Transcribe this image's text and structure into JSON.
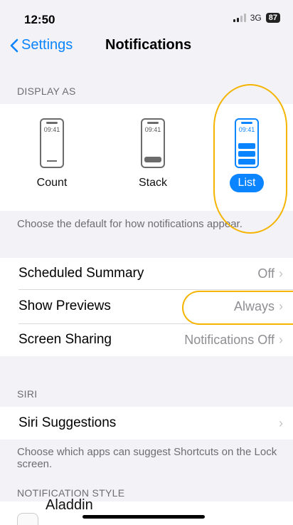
{
  "status_bar": {
    "time": "12:50",
    "network": "3G",
    "battery": "87"
  },
  "nav": {
    "back_label": "Settings",
    "title": "Notifications"
  },
  "display_as": {
    "header": "DISPLAY AS",
    "options": [
      {
        "label": "Count",
        "clock": "09:41",
        "selected": false
      },
      {
        "label": "Stack",
        "clock": "09:41",
        "selected": false
      },
      {
        "label": "List",
        "clock": "09:41",
        "selected": true
      }
    ],
    "footer": "Choose the default for how notifications appear."
  },
  "settings_rows": [
    {
      "label": "Scheduled Summary",
      "value": "Off"
    },
    {
      "label": "Show Previews",
      "value": "Always"
    },
    {
      "label": "Screen Sharing",
      "value": "Notifications Off"
    }
  ],
  "siri": {
    "header": "SIRI",
    "row_label": "Siri Suggestions",
    "footer": "Choose which apps can suggest Shortcuts on the Lock screen."
  },
  "notification_style": {
    "header": "NOTIFICATION STYLE",
    "first_app": "Aladdin"
  },
  "colors": {
    "accent": "#0a84ff",
    "highlight": "#f4b400",
    "background": "#f2f2f7"
  }
}
